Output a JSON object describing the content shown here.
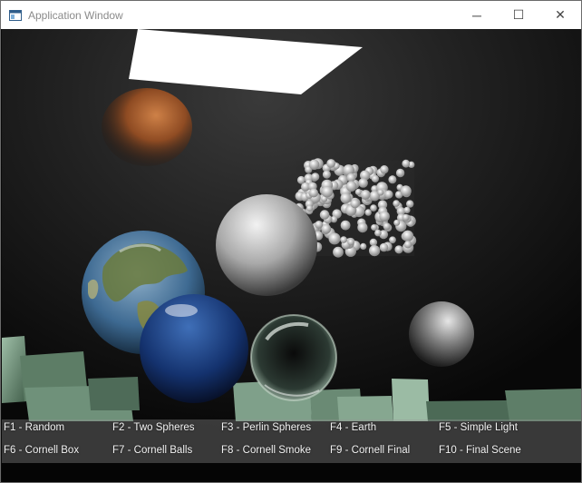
{
  "window": {
    "title": "Application Window",
    "controls": {
      "minimize_glyph": "─",
      "maximize_glyph": "☐",
      "close_glyph": "✕"
    }
  },
  "scene_menu": {
    "row1": [
      {
        "label": "F1 - Random"
      },
      {
        "label": "F2 - Two Spheres"
      },
      {
        "label": "F3 - Perlin Spheres"
      },
      {
        "label": "F4 - Earth"
      },
      {
        "label": "F5 - Simple Light"
      }
    ],
    "row2": [
      {
        "label": "F6 - Cornell Box"
      },
      {
        "label": "F7 - Cornell Balls"
      },
      {
        "label": "F8 - Cornell Smoke"
      },
      {
        "label": "F9 - Cornell Final"
      },
      {
        "label": "F10 - Final Scene"
      }
    ]
  },
  "icons": {
    "app": "window-app-icon",
    "minimize": "minimize-icon",
    "maximize": "maximize-icon",
    "close": "close-icon"
  },
  "colors": {
    "titlebar_bg": "#ffffff",
    "title_text": "#8a8a8a",
    "menu_text": "#f2f2f2",
    "scene_bg": "#0a0a0a"
  }
}
